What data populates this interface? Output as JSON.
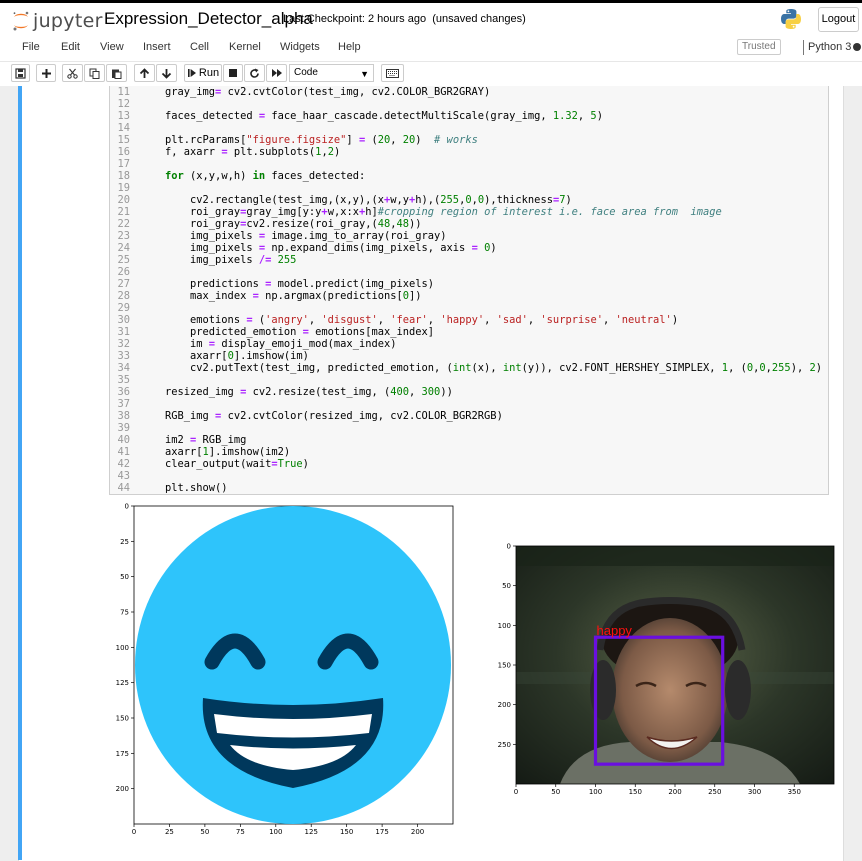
{
  "header": {
    "logo_text": "jupyter",
    "notebook_title": "Expression_Detector_alpha",
    "checkpoint_text": "Last Checkpoint: 2 hours ago",
    "unsaved_text": "(unsaved changes)",
    "logout_label": "Logout"
  },
  "menu": {
    "items": [
      "File",
      "Edit",
      "View",
      "Insert",
      "Cell",
      "Kernel",
      "Widgets",
      "Help"
    ],
    "trusted_label": "Trusted",
    "kernel_name": "Python 3"
  },
  "toolbar": {
    "buttons": [
      "save-icon",
      "add-cell-icon",
      "cut-icon",
      "copy-icon",
      "paste-icon",
      "move-up-icon",
      "move-down-icon",
      "run-icon",
      "stop-icon",
      "restart-icon",
      "fast-forward-icon",
      "keyboard-icon"
    ],
    "run_label": "Run",
    "cell_type": "Code"
  },
  "code": {
    "lines": [
      {
        "n": "11",
        "t": "    gray_img= cv2.cvtColor(test_img, cv2.COLOR_BGR2GRAY)"
      },
      {
        "n": "12",
        "t": ""
      },
      {
        "n": "13",
        "t": "    faces_detected = face_haar_cascade.detectMultiScale(gray_img, 1.32, 5)"
      },
      {
        "n": "14",
        "t": ""
      },
      {
        "n": "15",
        "t": "    plt.rcParams[\"figure.figsize\"] = (20, 20)  # works"
      },
      {
        "n": "16",
        "t": "    f, axarr = plt.subplots(1,2)"
      },
      {
        "n": "17",
        "t": ""
      },
      {
        "n": "18",
        "t": "    for (x,y,w,h) in faces_detected:"
      },
      {
        "n": "19",
        "t": ""
      },
      {
        "n": "20",
        "t": "        cv2.rectangle(test_img,(x,y),(x+w,y+h),(255,0,0),thickness=7)"
      },
      {
        "n": "21",
        "t": "        roi_gray=gray_img[y:y+w,x:x+h]#cropping region of interest i.e. face area from  image"
      },
      {
        "n": "22",
        "t": "        roi_gray=cv2.resize(roi_gray,(48,48))"
      },
      {
        "n": "23",
        "t": "        img_pixels = image.img_to_array(roi_gray)"
      },
      {
        "n": "24",
        "t": "        img_pixels = np.expand_dims(img_pixels, axis = 0)"
      },
      {
        "n": "25",
        "t": "        img_pixels /= 255"
      },
      {
        "n": "26",
        "t": ""
      },
      {
        "n": "27",
        "t": "        predictions = model.predict(img_pixels)"
      },
      {
        "n": "28",
        "t": "        max_index = np.argmax(predictions[0])"
      },
      {
        "n": "29",
        "t": ""
      },
      {
        "n": "30",
        "t": "        emotions = ('angry', 'disgust', 'fear', 'happy', 'sad', 'surprise', 'neutral')"
      },
      {
        "n": "31",
        "t": "        predicted_emotion = emotions[max_index]"
      },
      {
        "n": "32",
        "t": "        im = display_emoji_mod(max_index)"
      },
      {
        "n": "33",
        "t": "        axarr[0].imshow(im)"
      },
      {
        "n": "34",
        "t": "        cv2.putText(test_img, predicted_emotion, (int(x), int(y)), cv2.FONT_HERSHEY_SIMPLEX, 1, (0,0,255), 2)"
      },
      {
        "n": "35",
        "t": ""
      },
      {
        "n": "36",
        "t": "    resized_img = cv2.resize(test_img, (400, 300))"
      },
      {
        "n": "37",
        "t": ""
      },
      {
        "n": "38",
        "t": "    RGB_img = cv2.cvtColor(resized_img, cv2.COLOR_BGR2RGB)"
      },
      {
        "n": "39",
        "t": ""
      },
      {
        "n": "40",
        "t": "    im2 = RGB_img"
      },
      {
        "n": "41",
        "t": "    axarr[1].imshow(im2)"
      },
      {
        "n": "42",
        "t": "    clear_output(wait=True)"
      },
      {
        "n": "43",
        "t": ""
      },
      {
        "n": "44",
        "t": "    plt.show()"
      }
    ]
  },
  "plots": {
    "left": {
      "x_ticks": [
        "0",
        "25",
        "50",
        "75",
        "100",
        "125",
        "150",
        "175",
        "200"
      ],
      "y_ticks": [
        "0",
        "25",
        "50",
        "75",
        "100",
        "125",
        "150",
        "175",
        "200"
      ],
      "xlim": [
        0,
        225
      ],
      "ylim": [
        225,
        0
      ]
    },
    "right": {
      "x_ticks": [
        "0",
        "50",
        "100",
        "150",
        "200",
        "250",
        "300",
        "350"
      ],
      "y_ticks": [
        "0",
        "50",
        "100",
        "150",
        "200",
        "250"
      ],
      "xlim": [
        0,
        400
      ],
      "ylim": [
        300,
        0
      ],
      "face_label": "happy",
      "face_box": {
        "x0": 100,
        "y0": 115,
        "x1": 260,
        "y1": 275
      }
    }
  },
  "colors": {
    "emoji_face": "#2ec4fb",
    "emoji_feature": "#00385c",
    "face_box": "#6a0fe0",
    "face_label": "#ff1010",
    "cell_selected_bar": "#42a5f5"
  }
}
